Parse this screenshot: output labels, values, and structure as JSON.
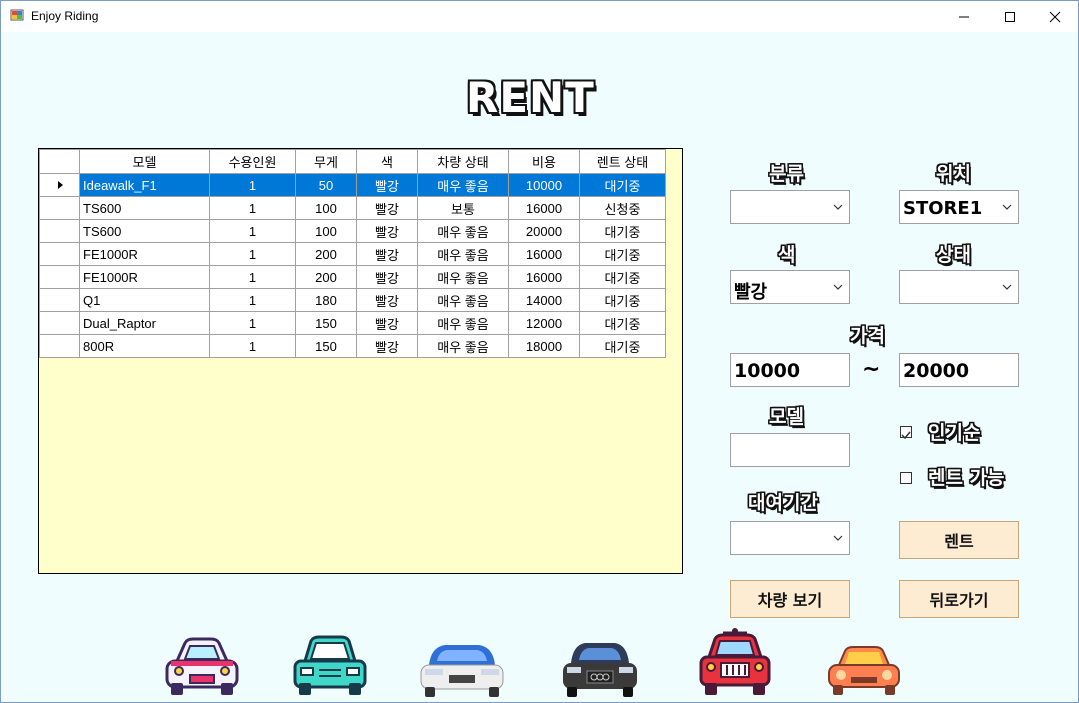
{
  "window": {
    "title": "Enjoy Riding"
  },
  "header": {
    "title": "RENT"
  },
  "grid": {
    "columns": [
      "모델",
      "수용인원",
      "무게",
      "색",
      "차량 상태",
      "비용",
      "렌트 상태"
    ],
    "rows": [
      [
        "Ideawalk_F1",
        "1",
        "50",
        "빨강",
        "매우 좋음",
        "10000",
        "대기중"
      ],
      [
        "TS600",
        "1",
        "100",
        "빨강",
        "보통",
        "16000",
        "신청중"
      ],
      [
        "TS600",
        "1",
        "100",
        "빨강",
        "매우 좋음",
        "20000",
        "대기중"
      ],
      [
        "FE1000R",
        "1",
        "200",
        "빨강",
        "매우 좋음",
        "16000",
        "대기중"
      ],
      [
        "FE1000R",
        "1",
        "200",
        "빨강",
        "매우 좋음",
        "16000",
        "대기중"
      ],
      [
        "Q1",
        "1",
        "180",
        "빨강",
        "매우 좋음",
        "14000",
        "대기중"
      ],
      [
        "Dual_Raptor",
        "1",
        "150",
        "빨강",
        "매우 좋음",
        "12000",
        "대기중"
      ],
      [
        "800R",
        "1",
        "150",
        "빨강",
        "매우 좋음",
        "18000",
        "대기중"
      ]
    ]
  },
  "filters": {
    "category": {
      "label": "분류",
      "value": ""
    },
    "location": {
      "label": "위치",
      "value": "STORE1"
    },
    "color": {
      "label": "색",
      "value": "빨강"
    },
    "status": {
      "label": "상태",
      "value": ""
    },
    "price": {
      "label": "가격",
      "min": "10000",
      "separator": "~",
      "max": "20000"
    },
    "model": {
      "label": "모델",
      "value": ""
    },
    "popular": {
      "label": "인기순",
      "checked": true
    },
    "rentable": {
      "label": "렌트 가능",
      "checked": false
    },
    "period": {
      "label": "대여기간",
      "value": ""
    }
  },
  "buttons": {
    "rent": "렌트",
    "view_vehicle": "차량 보기",
    "back": "뒤로가기"
  },
  "colors": {
    "selection": "#0078d7",
    "grid_background": "#ffffcc",
    "window_background": "#f0fdff",
    "button_background": "#fdecd2"
  }
}
